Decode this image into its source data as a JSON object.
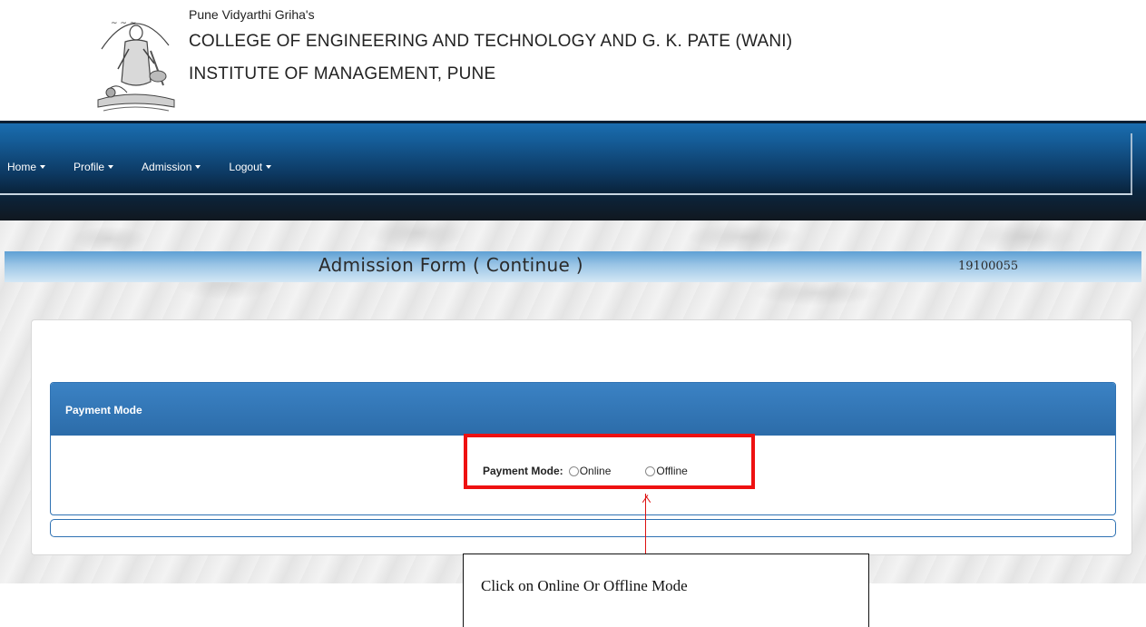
{
  "header": {
    "pre_title": "Pune Vidyarthi Griha's",
    "college_line1": "COLLEGE OF ENGINEERING AND TECHNOLOGY AND G. K. PATE (WANI)",
    "college_line2": "INSTITUTE OF MANAGEMENT, PUNE",
    "logo_icon": "saraswati-emblem-icon"
  },
  "navbar": {
    "items": [
      {
        "label": "Home",
        "icon": "caret-down-icon"
      },
      {
        "label": "Profile",
        "icon": "caret-down-icon"
      },
      {
        "label": "Admission",
        "icon": "caret-down-icon"
      },
      {
        "label": "Logout",
        "icon": "caret-down-icon"
      }
    ],
    "colors": {
      "top": "#1b6fb3",
      "bottom": "#111820"
    }
  },
  "page": {
    "title": "Admission Form ( Continue )",
    "form_id": "19100055"
  },
  "panel": {
    "title": "Payment Mode",
    "field_label": "Payment Mode:",
    "options": [
      {
        "label": "Online",
        "selected": false
      },
      {
        "label": "Offline",
        "selected": false
      }
    ],
    "header_color": "#2c6ca9"
  },
  "annotation": {
    "text": "Click on Online Or Offline Mode",
    "color": "#ee1111"
  }
}
